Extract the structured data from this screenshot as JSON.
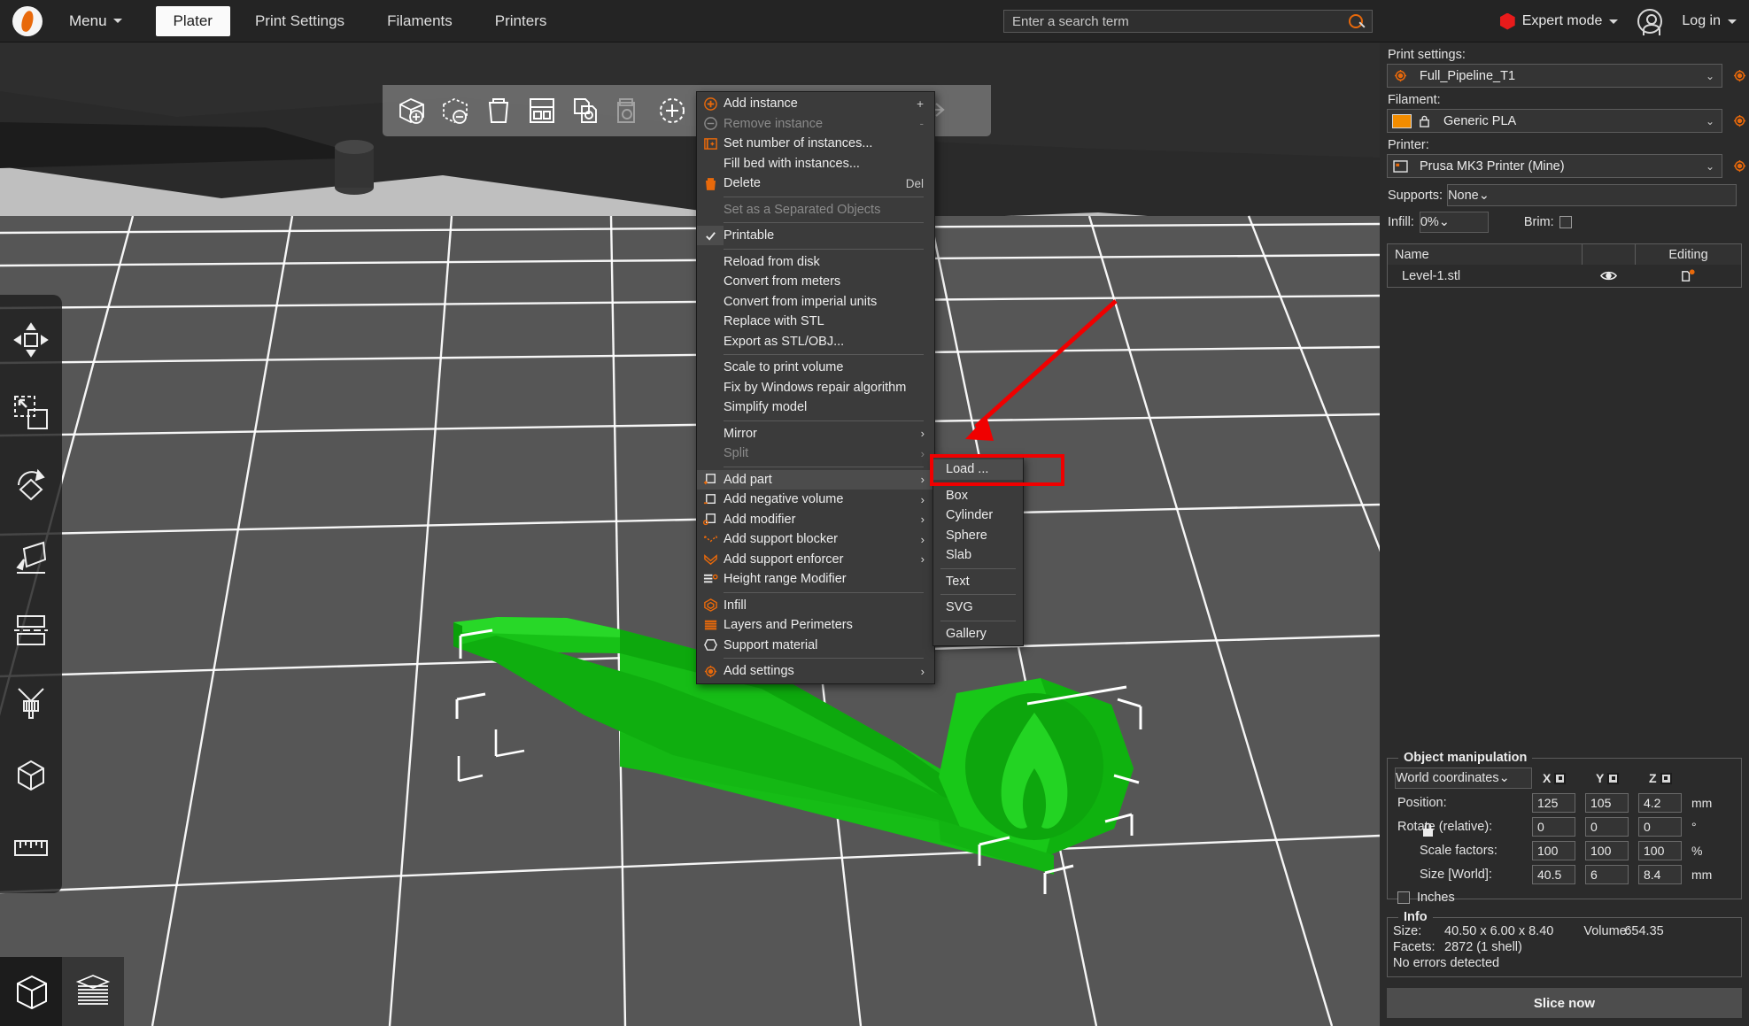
{
  "app": {
    "menu_label": "Menu",
    "tabs": [
      {
        "label": "Plater",
        "active": true
      },
      {
        "label": "Print Settings",
        "active": false
      },
      {
        "label": "Filaments",
        "active": false
      },
      {
        "label": "Printers",
        "active": false
      }
    ],
    "search_placeholder": "Enter a search term",
    "mode_label": "Expert mode",
    "mode_color": "#e81b1b",
    "login_label": "Log in"
  },
  "toolbar": {
    "items": [
      {
        "name": "add-object",
        "enabled": true
      },
      {
        "name": "delete-selection",
        "enabled": true
      },
      {
        "name": "delete-all",
        "enabled": true
      },
      {
        "name": "arrange",
        "enabled": true
      },
      {
        "name": "copy",
        "enabled": true
      },
      {
        "name": "paste",
        "enabled": false
      },
      {
        "name": "add-instance",
        "enabled": true
      },
      {
        "name": "remove-instance",
        "enabled": false
      },
      {
        "name": "split-to-objects",
        "enabled": false
      },
      {
        "name": "split-to-parts",
        "enabled": false
      },
      {
        "name": "layers-editing",
        "enabled": true
      },
      {
        "name": "undo",
        "enabled": true
      },
      {
        "name": "redo",
        "enabled": false
      }
    ]
  },
  "gizmos": [
    "move",
    "scale",
    "rotate",
    "place-on-face",
    "cut",
    "paint-support",
    "seam",
    "measure"
  ],
  "view_switch": [
    "editor-3d",
    "preview-layers"
  ],
  "context_menu": {
    "items": [
      {
        "label": "Add instance",
        "icon": "plus-circle",
        "accel": "+",
        "enabled": true,
        "sep_after": false
      },
      {
        "label": "Remove instance",
        "icon": "minus-circle",
        "accel": "-",
        "enabled": false,
        "sep_after": false
      },
      {
        "label": "Set number of instances...",
        "icon": "instances",
        "accel": "",
        "enabled": true,
        "sep_after": false
      },
      {
        "label": "Fill bed with instances...",
        "icon": "",
        "accel": "",
        "enabled": true,
        "sep_after": false
      },
      {
        "label": "Delete",
        "icon": "trash",
        "accel": "Del",
        "enabled": true,
        "sep_after": true
      },
      {
        "label": "Set as a Separated Objects",
        "icon": "",
        "accel": "",
        "enabled": false,
        "sep_after": true
      },
      {
        "label": "Printable",
        "icon": "check",
        "accel": "",
        "enabled": true,
        "sep_after": true,
        "checked": true
      },
      {
        "label": "Reload from disk",
        "icon": "",
        "accel": "",
        "enabled": true,
        "sep_after": false
      },
      {
        "label": "Convert from meters",
        "icon": "",
        "accel": "",
        "enabled": true,
        "sep_after": false
      },
      {
        "label": "Convert from imperial units",
        "icon": "",
        "accel": "",
        "enabled": true,
        "sep_after": false
      },
      {
        "label": "Replace with STL",
        "icon": "",
        "accel": "",
        "enabled": true,
        "sep_after": false
      },
      {
        "label": "Export as STL/OBJ...",
        "icon": "",
        "accel": "",
        "enabled": true,
        "sep_after": true
      },
      {
        "label": "Scale to print volume",
        "icon": "",
        "accel": "",
        "enabled": true,
        "sep_after": false
      },
      {
        "label": "Fix by Windows repair algorithm",
        "icon": "",
        "accel": "",
        "enabled": true,
        "sep_after": false
      },
      {
        "label": "Simplify model",
        "icon": "",
        "accel": "",
        "enabled": true,
        "sep_after": true
      },
      {
        "label": "Mirror",
        "icon": "",
        "accel": "",
        "enabled": true,
        "submenu": true,
        "sep_after": false
      },
      {
        "label": "Split",
        "icon": "",
        "accel": "",
        "enabled": false,
        "submenu": true,
        "sep_after": true
      },
      {
        "label": "Add part",
        "icon": "part",
        "accel": "",
        "enabled": true,
        "submenu": true,
        "highlighted": true,
        "sep_after": false
      },
      {
        "label": "Add negative volume",
        "icon": "negative",
        "accel": "",
        "enabled": true,
        "submenu": true,
        "sep_after": false
      },
      {
        "label": "Add modifier",
        "icon": "modifier",
        "accel": "",
        "enabled": true,
        "submenu": true,
        "sep_after": false
      },
      {
        "label": "Add support blocker",
        "icon": "blocker",
        "accel": "",
        "enabled": true,
        "submenu": true,
        "sep_after": false
      },
      {
        "label": "Add support enforcer",
        "icon": "enforcer",
        "accel": "",
        "enabled": true,
        "submenu": true,
        "sep_after": false
      },
      {
        "label": "Height range Modifier",
        "icon": "heightrange",
        "accel": "",
        "enabled": true,
        "sep_after": true
      },
      {
        "label": "Infill",
        "icon": "infill",
        "accel": "",
        "enabled": true,
        "sep_after": false
      },
      {
        "label": "Layers and Perimeters",
        "icon": "layers",
        "accel": "",
        "enabled": true,
        "sep_after": false
      },
      {
        "label": "Support material",
        "icon": "supportmat",
        "accel": "",
        "enabled": true,
        "sep_after": true
      },
      {
        "label": "Add settings",
        "icon": "gear",
        "accel": "",
        "enabled": true,
        "submenu": true,
        "sep_after": false
      }
    ]
  },
  "submenu": {
    "items": [
      {
        "label": "Load ...",
        "highlighted": true,
        "sep_after": true
      },
      {
        "label": "Box",
        "highlighted": false,
        "sep_after": false
      },
      {
        "label": "Cylinder",
        "highlighted": false,
        "sep_after": false
      },
      {
        "label": "Sphere",
        "highlighted": false,
        "sep_after": false
      },
      {
        "label": "Slab",
        "highlighted": false,
        "sep_after": true
      },
      {
        "label": "Text",
        "highlighted": false,
        "sep_after": true
      },
      {
        "label": "SVG",
        "highlighted": false,
        "sep_after": true
      },
      {
        "label": "Gallery",
        "highlighted": false,
        "sep_after": false
      }
    ]
  },
  "annotation": {
    "color": "#f00000",
    "shape": "arrow-to-load"
  },
  "right_panel": {
    "print_settings_label": "Print settings:",
    "print_settings_value": "Full_Pipeline_T1",
    "filament_label": "Filament:",
    "filament_value": "Generic PLA",
    "filament_color": "#f28c00",
    "printer_label": "Printer:",
    "printer_value": "Prusa MK3 Printer (Mine)",
    "supports_label": "Supports:",
    "supports_value": "None",
    "infill_label": "Infill:",
    "infill_value": "0%",
    "brim_label": "Brim:",
    "brim_checked": false,
    "object_list": {
      "headers": {
        "name": "Name",
        "eye": "",
        "editing": "Editing"
      },
      "rows": [
        {
          "name": "Level-1.stl",
          "visible": true,
          "editing": "settings"
        }
      ]
    },
    "object_manipulation": {
      "title": "Object manipulation",
      "coordinates": "World coordinates",
      "axes": [
        "X",
        "Y",
        "Z"
      ],
      "rows": [
        {
          "label": "Position:",
          "values": [
            "125",
            "105",
            "4.2"
          ],
          "unit": "mm",
          "indent": false
        },
        {
          "label": "Rotate (relative):",
          "values": [
            "0",
            "0",
            "0"
          ],
          "unit": "°",
          "indent": false
        },
        {
          "label": "Scale factors:",
          "values": [
            "100",
            "100",
            "100"
          ],
          "unit": "%",
          "indent": true
        },
        {
          "label": "Size [World]:",
          "values": [
            "40.5",
            "6",
            "8.4"
          ],
          "unit": "mm",
          "indent": true
        }
      ],
      "inches_label": "Inches",
      "inches_checked": false
    },
    "info": {
      "title": "Info",
      "size_label": "Size:",
      "size_value": "40.50 x 6.00 x 8.40",
      "volume_label": "Volume:",
      "volume_value": "654.35",
      "facets_label": "Facets:",
      "facets_value": "2872 (1 shell)",
      "status": "No errors detected"
    },
    "slice_label": "Slice now"
  },
  "viewport": {
    "bg_top": "#bfbfbf",
    "bed_color": "#555555",
    "grid_color": "#ffffff",
    "model_color": "#18c318"
  }
}
